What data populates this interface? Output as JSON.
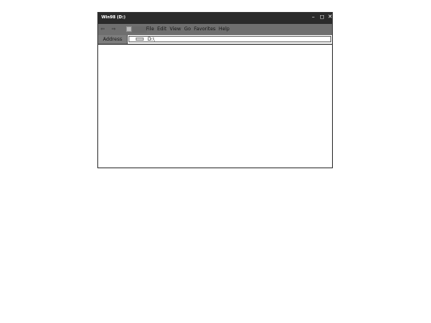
{
  "window": {
    "title": "Win98 (D:)",
    "controls": [
      "–",
      "◻",
      "✕"
    ]
  },
  "toolbar": {
    "back_label": "⇦",
    "forward_label": "⇨",
    "menus": [
      "File",
      "Edit",
      "View",
      "Go",
      "Favorites",
      "Help"
    ]
  },
  "addressbar": {
    "label": "Address",
    "value": "D:\\"
  },
  "icons": {
    "back": "back-arrow-icon",
    "forward": "forward-arrow-icon",
    "up": "up-folder-icon",
    "drive": "drive-icon"
  }
}
